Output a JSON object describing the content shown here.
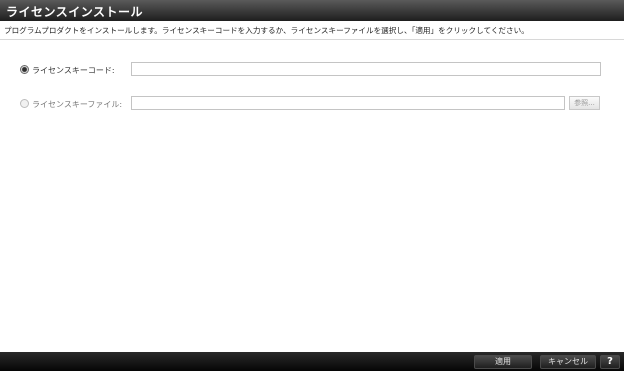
{
  "window": {
    "title": "ライセンスインストール"
  },
  "instruction": "プログラムプロダクトをインストールします。ライセンスキーコードを入力するか、ライセンスキーファイルを選択し、「適用」をクリックしてください。",
  "form": {
    "license_key_code": {
      "label": "ライセンスキーコード:",
      "value": "",
      "selected": true
    },
    "license_key_file": {
      "label": "ライセンスキーファイル:",
      "value": "",
      "selected": false,
      "browse_label": "参照..."
    }
  },
  "footer": {
    "apply_label": "適用",
    "cancel_label": "キャンセル",
    "help_label": "?"
  }
}
